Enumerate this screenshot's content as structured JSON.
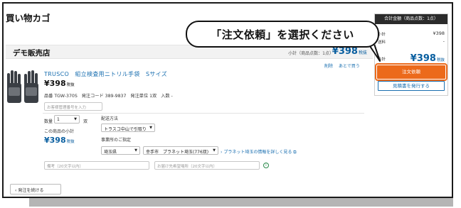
{
  "page": {
    "title": "買い物カゴ"
  },
  "shop": {
    "name": "デモ販売店",
    "subtotal_label": "小計（商品点数：1点）",
    "subtotal_price": "¥398",
    "subtotal_tax": "税抜"
  },
  "item_links": {
    "delete": "削除",
    "later": "あとで買う"
  },
  "product": {
    "name": "TRUSCO　組立検査用ニトリル手袋　Sサイズ",
    "price": "¥398",
    "price_tax": "税抜",
    "specs": [
      "品番 TGW-370S",
      "発注コード 389-9837",
      "発注単位 1双",
      "入数 -"
    ],
    "mgmt_placeholder": "お客様管理番号を入力"
  },
  "order_form": {
    "qty_label": "数量",
    "qty_value": "1",
    "qty_unit": "双",
    "item_subtotal_label": "この商品の小計",
    "item_subtotal_price": "¥398",
    "item_subtotal_tax": "税抜",
    "shipping_label": "配送方法",
    "shipping_value": "トラスコ中山で引取り",
    "office_label": "事業所のご指定",
    "prefecture_value": "埼玉県",
    "office_value": "幸手市　プラネット埼玉(776双)",
    "office_link": "プラネット埼玉の情報を詳しく見る",
    "note_placeholder": "備考（20文字以内）",
    "destination_placeholder": "お届け先希望場所（20文字以内）",
    "info_icon": "i"
  },
  "continue_button": "発注を続ける",
  "summary": {
    "header": "合計金額（商品点数：1点）",
    "subtotal_label": "小計",
    "subtotal_value": "¥398",
    "shipping_label": "送料",
    "shipping_value": "-",
    "total_label": "合計",
    "total_value": "¥398",
    "total_tax": "税抜",
    "order_button": "注文依頼",
    "estimate_button": "見積書を発行する"
  },
  "callout": {
    "text": "「注文依頼」を選択ください"
  },
  "colors": {
    "accent_orange": "#ec6a1b",
    "link_blue": "#1a6fb0",
    "price_blue": "#0a5fa0"
  },
  "icons": {
    "caret": "chevron-down-icon",
    "link_arrow": "chevron-right-icon",
    "external": "external-link-icon"
  }
}
